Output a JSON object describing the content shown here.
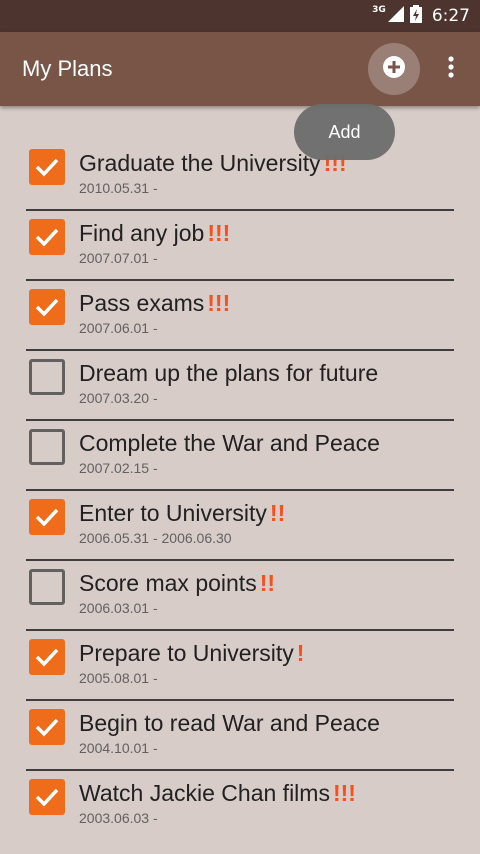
{
  "status_bar": {
    "network": "3G",
    "time": "6:27"
  },
  "app_bar": {
    "title": "My Plans",
    "add_icon": "add-circle-icon",
    "more_icon": "more-vert-icon"
  },
  "tooltip": {
    "text": "Add"
  },
  "colors": {
    "app_bar": "#795548",
    "status_bar": "#4e342e",
    "background": "#d7ccc8",
    "accent": "#ef6c1a",
    "priority": "#f4511e"
  },
  "plans": [
    {
      "title": "Graduate the University",
      "priority": "!!!",
      "dates": "2010.05.31 -",
      "checked": true
    },
    {
      "title": "Find any job",
      "priority": "!!!",
      "dates": "2007.07.01 -",
      "checked": true
    },
    {
      "title": "Pass exams",
      "priority": "!!!",
      "dates": "2007.06.01 -",
      "checked": true
    },
    {
      "title": "Dream up the plans for future",
      "priority": "",
      "dates": "2007.03.20 -",
      "checked": false
    },
    {
      "title": "Complete the War and Peace",
      "priority": "",
      "dates": "2007.02.15 -",
      "checked": false
    },
    {
      "title": "Enter to University",
      "priority": "!!",
      "dates": "2006.05.31 - 2006.06.30",
      "checked": true
    },
    {
      "title": "Score max points",
      "priority": "!!",
      "dates": "2006.03.01 -",
      "checked": false
    },
    {
      "title": "Prepare to University",
      "priority": "!",
      "dates": "2005.08.01 -",
      "checked": true
    },
    {
      "title": "Begin to read War and Peace",
      "priority": "",
      "dates": "2004.10.01 -",
      "checked": true
    },
    {
      "title": "Watch Jackie Chan films",
      "priority": "!!!",
      "dates": "2003.06.03 -",
      "checked": true
    }
  ]
}
